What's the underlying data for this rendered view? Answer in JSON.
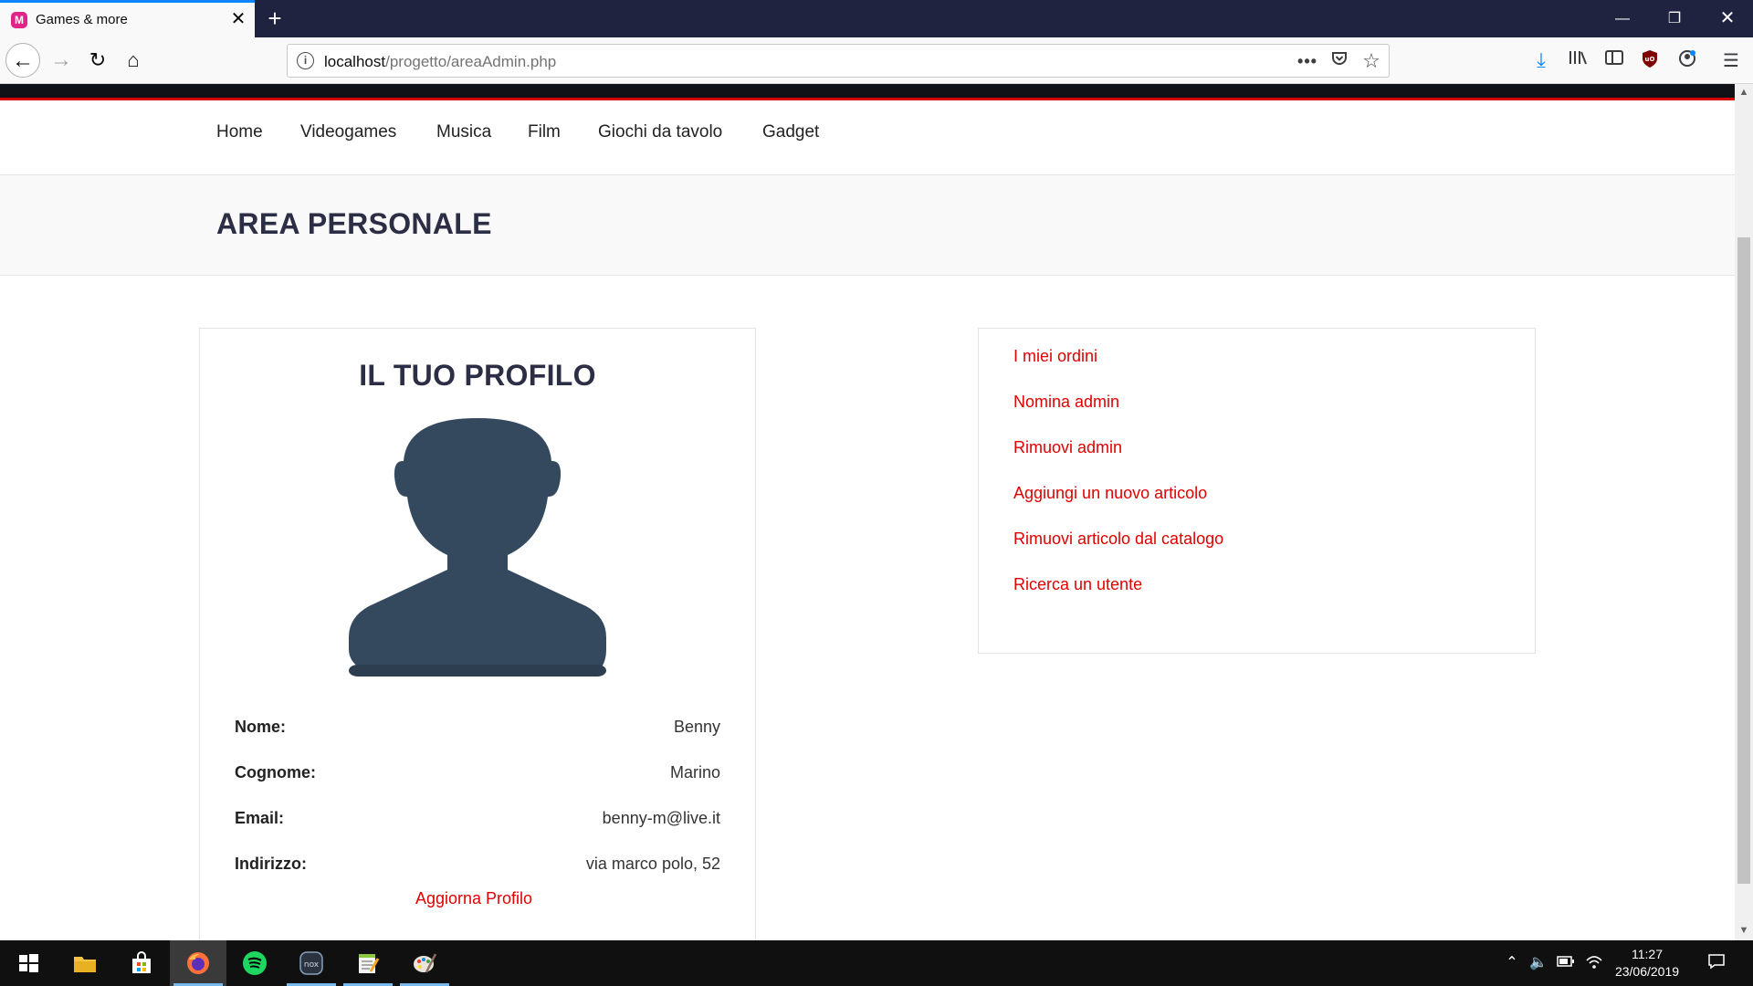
{
  "browser": {
    "tab_title": "Games & more",
    "favicon_glyph": "M",
    "url_host": "localhost",
    "url_path": "/progetto/areaAdmin.php",
    "icons": [
      "back-arrow-icon",
      "forward-arrow-icon",
      "reload-icon",
      "home-icon",
      "info-icon",
      "more-dots-icon",
      "pocket-icon",
      "bookmark-star-icon",
      "download-icon",
      "library-icon",
      "sidebar-icon",
      "ublock-icon",
      "account-icon",
      "menu-icon"
    ]
  },
  "site_nav": {
    "items": [
      "Home",
      "Videogames",
      "Musica",
      "Film",
      "Giochi da tavolo",
      "Gadget"
    ]
  },
  "page": {
    "title": "AREA PERSONALE"
  },
  "profile": {
    "title": "IL TUO PROFILO",
    "fields": [
      {
        "label": "Nome:",
        "value": "Benny"
      },
      {
        "label": "Cognome:",
        "value": "Marino"
      },
      {
        "label": "Email:",
        "value": "benny-m@live.it"
      },
      {
        "label": "Indirizzo:",
        "value": "via marco polo, 52"
      }
    ],
    "update_link": "Aggiorna Profilo"
  },
  "admin_menu": {
    "items": [
      "I miei ordini",
      "Nomina admin",
      "Rimuovi admin",
      "Aggiungi un nuovo articolo",
      "Rimuovi articolo dal catalogo",
      "Ricerca un utente"
    ]
  },
  "taskbar": {
    "time": "11:27",
    "date": "23/06/2019"
  },
  "colors": {
    "accent_red": "#e00000",
    "heading_navy": "#2b2e45",
    "avatar": "#34495e",
    "tab_bar": "#1f2340"
  }
}
